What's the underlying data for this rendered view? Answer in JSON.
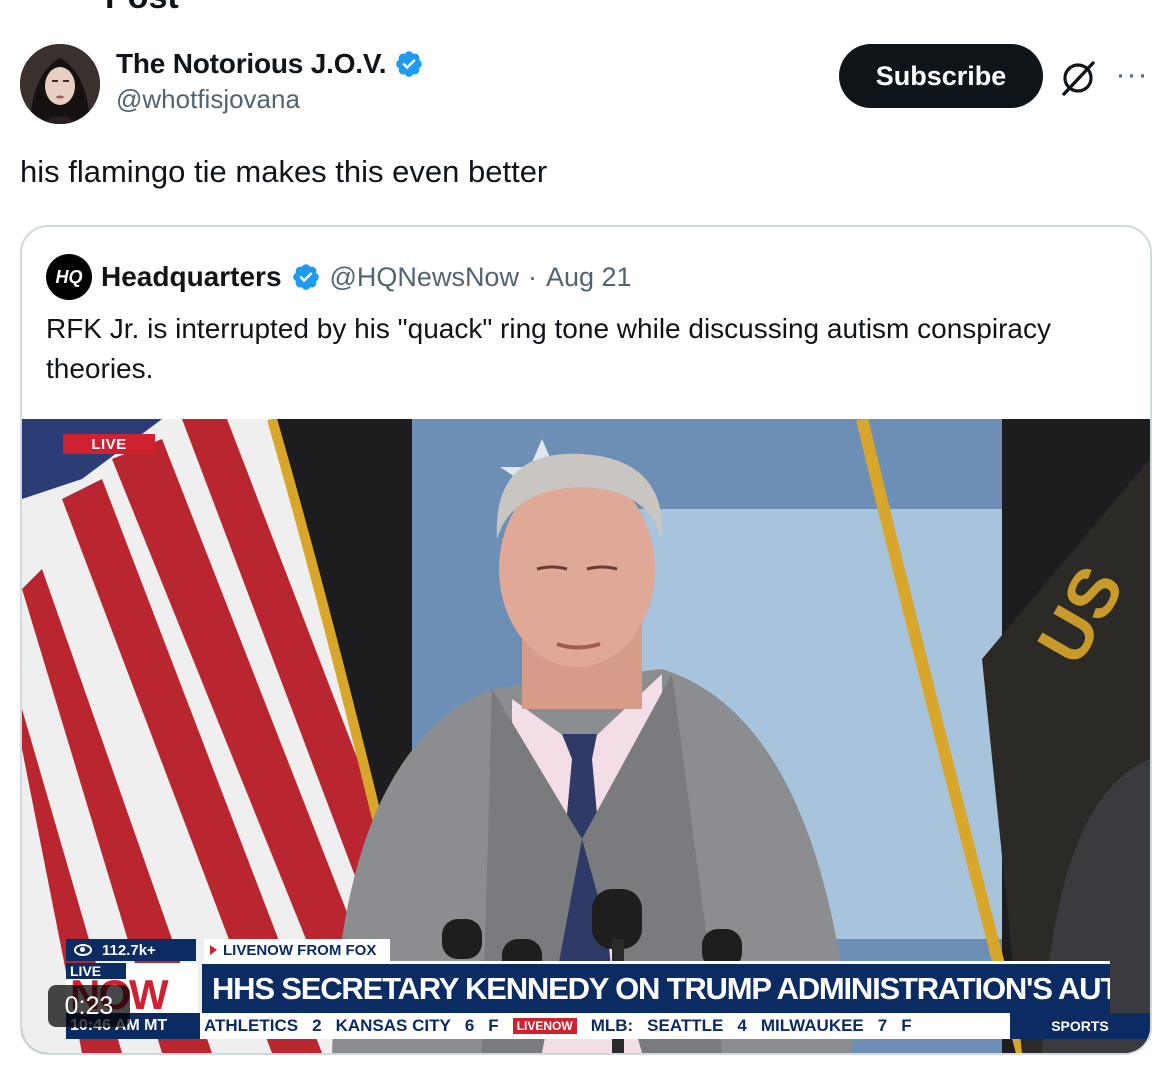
{
  "heading_partial": "Post",
  "post": {
    "author_name": "The Notorious J.O.V.",
    "author_handle": "@whotfisjovana",
    "subscribe_label": "Subscribe",
    "more_label": "···",
    "text": "his flamingo tie makes this even better"
  },
  "quote": {
    "avatar_text": "HQ",
    "author_name": "Headquarters",
    "author_handle": "@HQNewsNow",
    "separator": "·",
    "date": "Aug 21",
    "text": "RFK Jr. is interrupted by his \"quack\" ring tone while discussing autism conspiracy theories."
  },
  "video": {
    "live_tag": "LIVE",
    "viewers": "112.7k+",
    "source": "LIVENOW FROM FOX",
    "logo_live": "LIVE",
    "logo_now": "NOW",
    "headline": "HHS SECRETARY KENNEDY ON TRUMP ADMINISTRATION'S AUTISM EFFORTS",
    "ticker_time": "10:46 AM MT",
    "ticker_items": [
      "ATHLETICS",
      "2",
      "KANSAS CITY",
      "6",
      "F"
    ],
    "ticker_badge": "LIVENOW",
    "ticker_items_2": [
      "MLB:",
      "SEATTLE",
      "4",
      "MILWAUKEE",
      "7",
      "F"
    ],
    "ticker_sports": "SPORTS",
    "duration": "0:23"
  },
  "colors": {
    "verified": "#1d9bf0",
    "text_primary": "#0f1419",
    "text_secondary": "#536471",
    "fox_navy": "#0b2c63",
    "fox_red": "#cf2130"
  },
  "icons": {
    "verified": "verified-badge-icon",
    "grok": "grok-icon",
    "more": "more-icon"
  }
}
